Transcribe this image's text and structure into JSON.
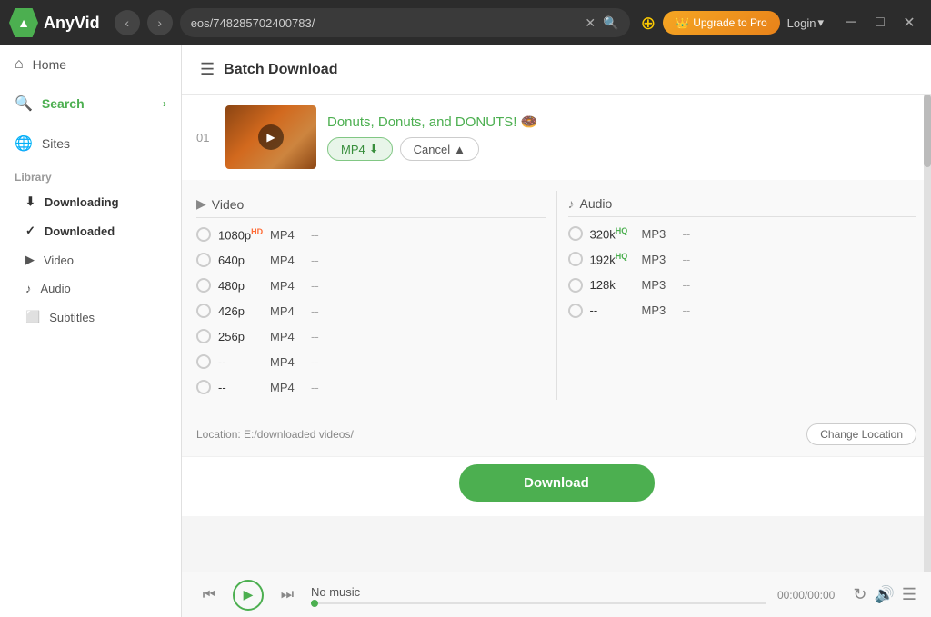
{
  "app": {
    "name": "AnyVid",
    "url": "eos/748285702400783/",
    "upgrade_label": "Upgrade to Pro",
    "login_label": "Login"
  },
  "sidebar": {
    "home_label": "Home",
    "search_label": "Search",
    "sites_label": "Sites",
    "library_label": "Library",
    "downloading_label": "Downloading",
    "downloaded_label": "Downloaded",
    "video_label": "Video",
    "audio_label": "Audio",
    "subtitles_label": "Subtitles"
  },
  "batch": {
    "title": "Batch Download",
    "item_num": "01",
    "video_title": "Donuts, Donuts, and DONUTS!",
    "emoji": "🍩",
    "mp4_label": "MP4",
    "cancel_label": "Cancel"
  },
  "format_table": {
    "video_label": "Video",
    "audio_label": "Audio",
    "video_rows": [
      {
        "res": "1080p",
        "badge": "HD",
        "badge_type": "hd",
        "type": "MP4",
        "size": "--"
      },
      {
        "res": "640p",
        "badge": "",
        "badge_type": "",
        "type": "MP4",
        "size": "--"
      },
      {
        "res": "480p",
        "badge": "",
        "badge_type": "",
        "type": "MP4",
        "size": "--"
      },
      {
        "res": "426p",
        "badge": "",
        "badge_type": "",
        "type": "MP4",
        "size": "--"
      },
      {
        "res": "256p",
        "badge": "",
        "badge_type": "",
        "type": "MP4",
        "size": "--"
      },
      {
        "res": "--",
        "badge": "",
        "badge_type": "",
        "type": "MP4",
        "size": "--"
      },
      {
        "res": "--",
        "badge": "",
        "badge_type": "",
        "type": "MP4",
        "size": "--"
      }
    ],
    "audio_rows": [
      {
        "res": "320k",
        "badge": "HQ",
        "badge_type": "hq",
        "type": "MP3",
        "size": "--"
      },
      {
        "res": "192k",
        "badge": "HQ",
        "badge_type": "hq",
        "type": "MP3",
        "size": "--"
      },
      {
        "res": "128k",
        "badge": "",
        "badge_type": "",
        "type": "MP3",
        "size": "--"
      },
      {
        "res": "--",
        "badge": "",
        "badge_type": "",
        "type": "MP3",
        "size": "--"
      }
    ]
  },
  "location": {
    "path": "Location: E:/downloaded videos/",
    "change_label": "Change Location"
  },
  "download_btn_label": "Download",
  "player": {
    "track_name": "No music",
    "time": "00:00/00:00"
  }
}
